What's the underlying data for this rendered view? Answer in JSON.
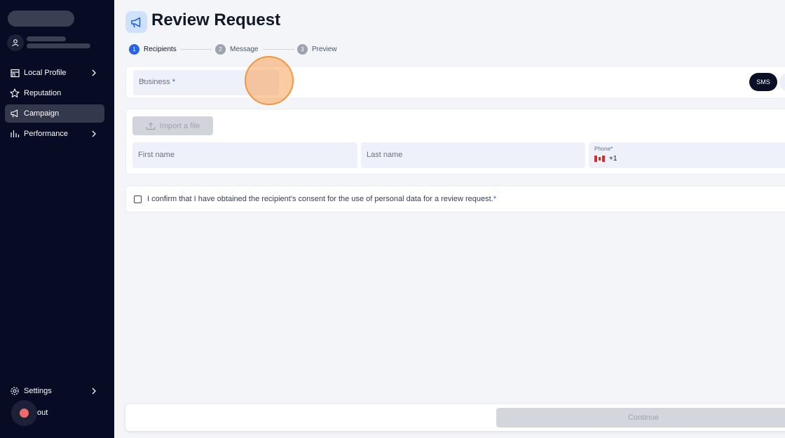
{
  "sidebar": {
    "items": [
      {
        "label": "Local Profile",
        "icon": "storefront-icon",
        "has_chevron": true
      },
      {
        "label": "Reputation",
        "icon": "star-icon",
        "has_chevron": false
      },
      {
        "label": "Campaign",
        "icon": "megaphone-icon",
        "has_chevron": false,
        "active": true
      },
      {
        "label": "Performance",
        "icon": "bar-chart-icon",
        "has_chevron": true
      }
    ],
    "settings_label": "Settings",
    "logout_label": "out"
  },
  "header": {
    "title": "Review Request",
    "icon": "megaphone-icon"
  },
  "steps": [
    {
      "number": "1",
      "label": "Recipients",
      "active": true
    },
    {
      "number": "2",
      "label": "Message",
      "active": false
    },
    {
      "number": "3",
      "label": "Preview",
      "active": false
    }
  ],
  "form": {
    "business_label": "Business",
    "required_mark": "*",
    "channel_selected": "SMS",
    "import_label": "Import a file",
    "first_name_placeholder": "First name",
    "last_name_placeholder": "Last name",
    "phone_label": "Phone",
    "phone_code": "+1",
    "consent_text": "I confirm that I have obtained the recipient's consent for the use of personal data for a review request."
  },
  "footer": {
    "continue_label": "Continue"
  },
  "colors": {
    "sidebar_bg": "#070b24",
    "accent": "#2563eb",
    "click_highlight": "#f2963f"
  }
}
